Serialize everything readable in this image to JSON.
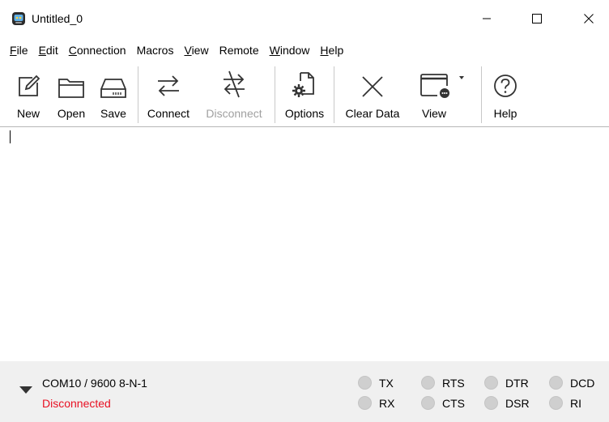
{
  "window": {
    "title": "Untitled_0",
    "controls": {
      "minimize": "minimize",
      "maximize": "maximize",
      "close": "close"
    }
  },
  "menu": [
    {
      "label": "File",
      "mnemonic": "F",
      "rest": "ile"
    },
    {
      "label": "Edit",
      "mnemonic": "E",
      "rest": "dit"
    },
    {
      "label": "Connection",
      "mnemonic": "C",
      "rest": "onnection"
    },
    {
      "label": "Macros",
      "mnemonic": "",
      "rest": "Macros"
    },
    {
      "label": "View",
      "mnemonic": "V",
      "rest": "iew"
    },
    {
      "label": "Remote",
      "mnemonic": "",
      "rest": "Remote"
    },
    {
      "label": "Window",
      "mnemonic": "W",
      "rest": "indow"
    },
    {
      "label": "Help",
      "mnemonic": "H",
      "rest": "elp"
    }
  ],
  "toolbar": {
    "new": {
      "label": "New",
      "icon": "new-document-icon"
    },
    "open": {
      "label": "Open",
      "icon": "folder-icon"
    },
    "save": {
      "label": "Save",
      "icon": "drive-icon"
    },
    "connect": {
      "label": "Connect",
      "icon": "connect-arrows-icon"
    },
    "disconnect": {
      "label": "Disconnect",
      "icon": "disconnect-arrows-icon",
      "enabled": false
    },
    "options": {
      "label": "Options",
      "icon": "options-gear-icon"
    },
    "clear": {
      "label": "Clear Data",
      "icon": "clear-x-icon"
    },
    "view": {
      "label": "View",
      "icon": "view-window-icon"
    },
    "help": {
      "label": "Help",
      "icon": "help-icon"
    }
  },
  "status": {
    "port": "COM10 / 9600 8-N-1",
    "connection": "Disconnected",
    "connection_color": "#e81123",
    "indicators": [
      {
        "name": "TX"
      },
      {
        "name": "RTS"
      },
      {
        "name": "DTR"
      },
      {
        "name": "DCD"
      },
      {
        "name": "RX"
      },
      {
        "name": "CTS"
      },
      {
        "name": "DSR"
      },
      {
        "name": "RI"
      }
    ],
    "indicator_off_color": "#cfcfcf"
  }
}
